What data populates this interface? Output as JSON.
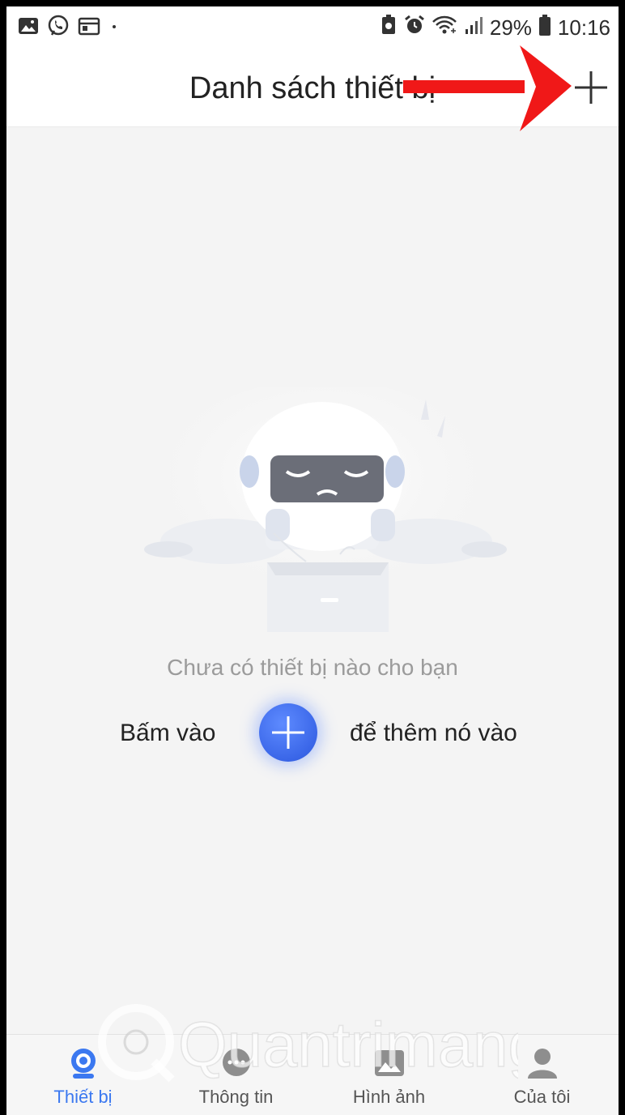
{
  "status_bar": {
    "battery": "29%",
    "time": "10:16",
    "left_icons": [
      "gallery-icon",
      "viber-icon",
      "calendar-icon",
      "dot-icon"
    ],
    "right_icons": [
      "battery-saver-icon",
      "alarm-icon",
      "wifi-icon",
      "signal-icon",
      "battery-icon"
    ]
  },
  "header": {
    "title": "Danh sách thiết bị",
    "add_icon": "plus-icon",
    "annotation_arrow_color": "#f01818"
  },
  "empty_state": {
    "message": "Chưa có thiết bị nào cho bạn",
    "hint_before": "Bấm vào",
    "hint_after": "để thêm nó vào",
    "button_icon": "plus-icon",
    "accent_color": "#3a66e8"
  },
  "tabs": [
    {
      "label": "Thiết bị",
      "icon": "camera-icon",
      "active": true
    },
    {
      "label": "Thông tin",
      "icon": "chat-icon",
      "active": false
    },
    {
      "label": "Hình ảnh",
      "icon": "image-icon",
      "active": false
    },
    {
      "label": "Của tôi",
      "icon": "user-icon",
      "active": false
    }
  ],
  "watermark": "Quantrimang"
}
